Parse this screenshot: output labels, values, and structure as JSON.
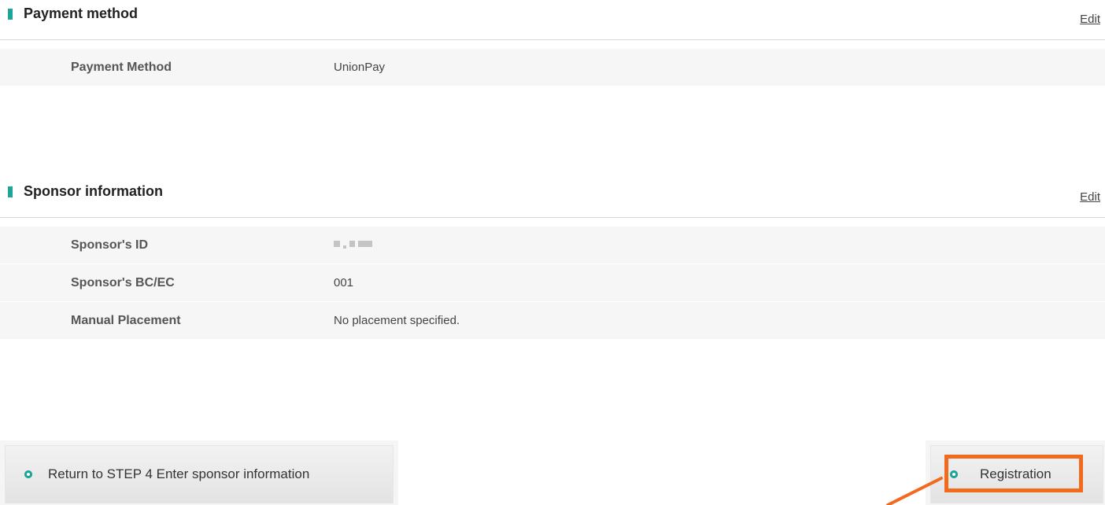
{
  "payment_section": {
    "title": "Payment method",
    "edit_label": "Edit",
    "rows": [
      {
        "label": "Payment Method",
        "value": "UnionPay"
      }
    ]
  },
  "sponsor_section": {
    "title": "Sponsor information",
    "edit_label": "Edit",
    "rows": [
      {
        "label": "Sponsor's ID",
        "value": ""
      },
      {
        "label": "Sponsor's BC/EC",
        "value": "001"
      },
      {
        "label": "Manual Placement",
        "value": "No placement specified."
      }
    ]
  },
  "actions": {
    "back_label": "Return to STEP 4 Enter sponsor information",
    "register_label": "Registration"
  },
  "colors": {
    "accent": "#1ea59a",
    "highlight": "#f26a1b"
  }
}
